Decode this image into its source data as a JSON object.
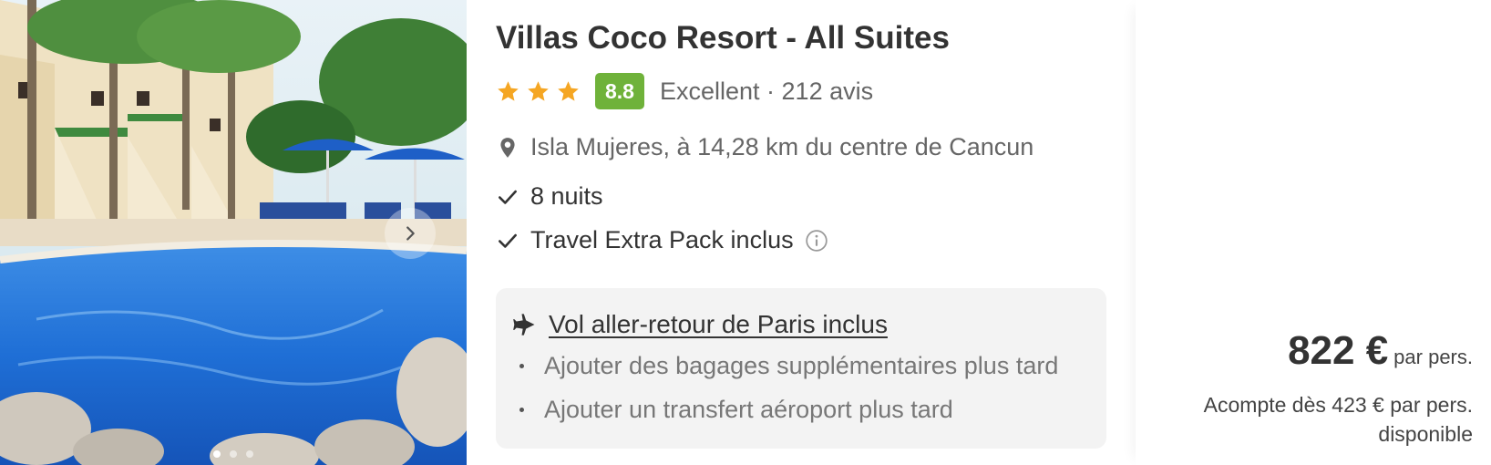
{
  "hotel": {
    "title": "Villas Coco Resort - All Suites",
    "stars": 3,
    "score": "8.8",
    "rating_label": "Excellent · 212 avis",
    "location": "Isla Mujeres, à 14,28 km du centre de Cancun",
    "features": [
      "8 nuits",
      "Travel Extra Pack inclus"
    ]
  },
  "flight": {
    "title": "Vol aller-retour de Paris inclus",
    "options": [
      "Ajouter des bagages supplémentaires plus tard",
      "Ajouter un transfert aéroport plus tard"
    ]
  },
  "price": {
    "amount": "822 €",
    "per": "par pers.",
    "deposit": "Acompte dès 423 € par pers. disponible"
  },
  "colors": {
    "star": "#f5a623",
    "score_bg": "#6fb23a",
    "flight_bg": "#f3f3f3"
  },
  "icons": [
    "location-pin-icon",
    "check-icon",
    "info-icon",
    "plane-icon",
    "star-icon",
    "chevron-right-icon"
  ]
}
